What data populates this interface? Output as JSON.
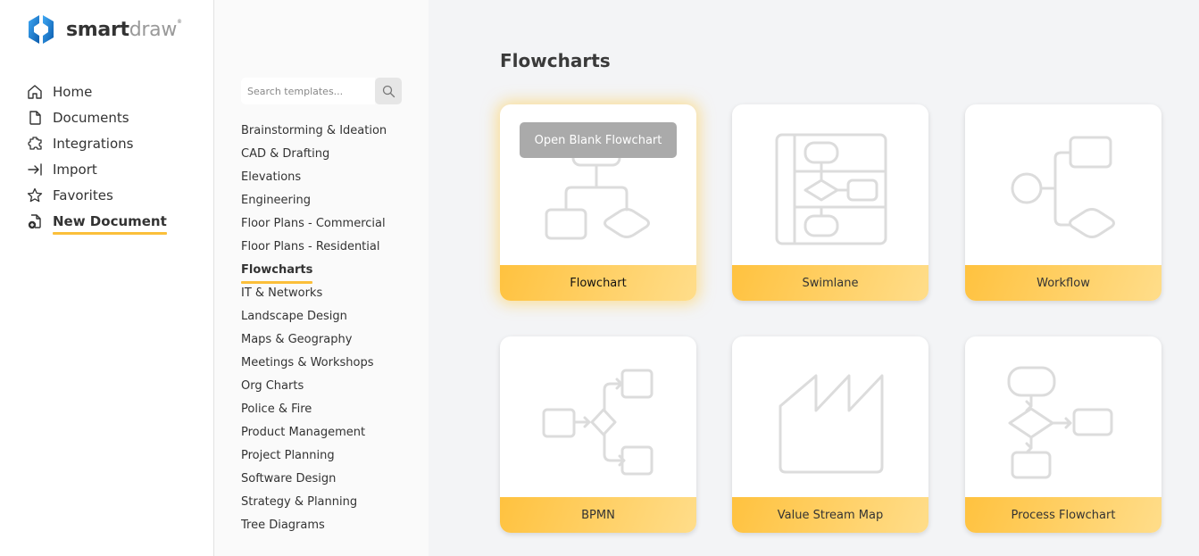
{
  "app": {
    "logo_primary": "smart",
    "logo_secondary": "draw",
    "logo_mark": "®"
  },
  "sidebar": {
    "items": [
      {
        "label": "Home",
        "icon": "home-icon"
      },
      {
        "label": "Documents",
        "icon": "document-icon"
      },
      {
        "label": "Integrations",
        "icon": "puzzle-icon"
      },
      {
        "label": "Import",
        "icon": "import-arrow-icon"
      },
      {
        "label": "Favorites",
        "icon": "star-icon"
      },
      {
        "label": "New Document",
        "icon": "new-document-icon",
        "active": true
      }
    ]
  },
  "categories": {
    "search_placeholder": "Search templates...",
    "search_value": "",
    "items": [
      "Brainstorming & Ideation",
      "CAD & Drafting",
      "Elevations",
      "Engineering",
      "Floor Plans - Commercial",
      "Floor Plans - Residential",
      "Flowcharts",
      "IT & Networks",
      "Landscape Design",
      "Maps & Geography",
      "Meetings & Workshops",
      "Org Charts",
      "Police & Fire",
      "Product Management",
      "Project Planning",
      "Software Design",
      "Strategy & Planning",
      "Tree Diagrams"
    ],
    "active": "Flowcharts"
  },
  "main": {
    "title": "Flowcharts",
    "open_blank_label": "Open Blank Flowchart",
    "templates": [
      {
        "label": "Flowchart",
        "thumb": "flowchart-thumbnail",
        "hovered": true
      },
      {
        "label": "Swimlane",
        "thumb": "swimlane-thumbnail"
      },
      {
        "label": "Workflow",
        "thumb": "workflow-thumbnail"
      },
      {
        "label": "BPMN",
        "thumb": "bpmn-thumbnail"
      },
      {
        "label": "Value Stream Map",
        "thumb": "factory-thumbnail"
      },
      {
        "label": "Process Flowchart",
        "thumb": "process-flowchart-thumbnail"
      }
    ]
  },
  "colors": {
    "accent": "#fbbf3a",
    "card_footer_start": "#ffc23f",
    "card_footer_end": "#ffdd8a",
    "logo_blue": "#1e7fd6"
  }
}
